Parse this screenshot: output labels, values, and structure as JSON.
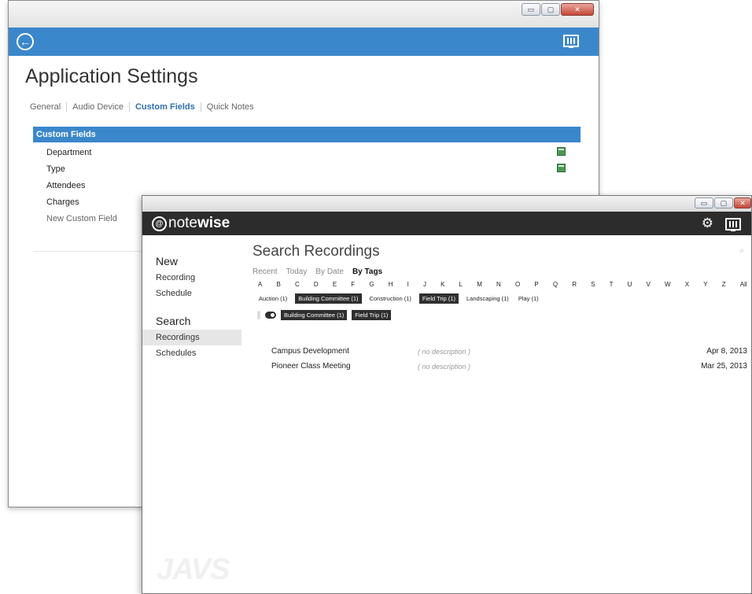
{
  "settings_window": {
    "title": "Application Settings",
    "tabs": [
      {
        "label": "General",
        "active": false
      },
      {
        "label": "Audio Device",
        "active": false
      },
      {
        "label": "Custom Fields",
        "active": true
      },
      {
        "label": "Quick Notes",
        "active": false
      }
    ],
    "section_header": "Custom Fields",
    "fields": [
      "Department",
      "Type",
      "Attendees",
      "Charges"
    ],
    "new_field_label": "New Custom Field",
    "accent_color": "#3b87cb"
  },
  "notewise_window": {
    "logo": {
      "prefix": "note",
      "suffix": "wise"
    },
    "nav": {
      "new_heading": "New",
      "new_items": [
        "Recording",
        "Schedule"
      ],
      "search_heading": "Search",
      "search_items": [
        "Recordings",
        "Schedules"
      ],
      "active_item": "Recordings"
    },
    "page_title": "Search Recordings",
    "filter_tabs": [
      {
        "label": "Recent",
        "active": false
      },
      {
        "label": "Today",
        "active": false
      },
      {
        "label": "By Date",
        "active": false
      },
      {
        "label": "By Tags",
        "active": true
      }
    ],
    "letters": [
      "A",
      "B",
      "C",
      "D",
      "E",
      "F",
      "G",
      "H",
      "I",
      "J",
      "K",
      "L",
      "M",
      "N",
      "O",
      "P",
      "Q",
      "R",
      "S",
      "T",
      "U",
      "V",
      "W",
      "X",
      "Y",
      "Z",
      "All"
    ],
    "tags": [
      {
        "label": "Auction (1)",
        "selected": false
      },
      {
        "label": "Building Committee (1)",
        "selected": true
      },
      {
        "label": "Construction (1)",
        "selected": false
      },
      {
        "label": "Field Trip (1)",
        "selected": true
      },
      {
        "label": "Landscaping (1)",
        "selected": false
      },
      {
        "label": "Play (1)",
        "selected": false
      }
    ],
    "active_filters": [
      "Building Committee (1)",
      "Field Trip (1)"
    ],
    "results": [
      {
        "name": "Campus Development",
        "description": "( no description )",
        "date": "Apr 8, 2013"
      },
      {
        "name": "Pioneer Class Meeting",
        "description": "( no description )",
        "date": "Mar 25, 2013"
      }
    ],
    "watermark": "JAVS",
    "header_color": "#2c2c2c"
  }
}
